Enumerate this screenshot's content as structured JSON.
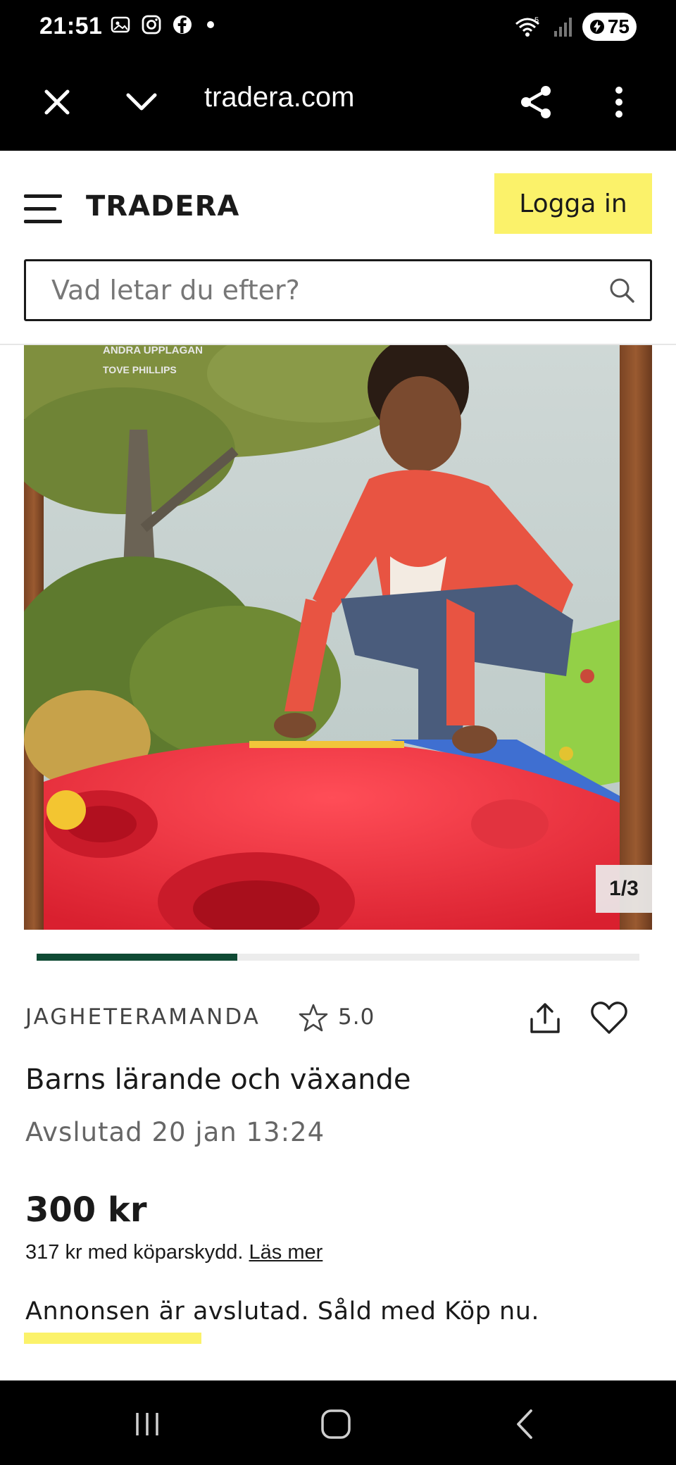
{
  "status_bar": {
    "time": "21:51",
    "battery": "75"
  },
  "browser": {
    "url": "tradera.com"
  },
  "header": {
    "logo": "TRADERA",
    "login_label": "Logga in"
  },
  "search": {
    "placeholder": "Vad letar du efter?"
  },
  "gallery": {
    "counter": "1/3",
    "progress_fraction": 0.3333
  },
  "listing": {
    "seller": "JAGHETERAMANDA",
    "rating": "5.0",
    "title": "Barns lärande och växande",
    "ended": "Avslutad 20 jan 13:24",
    "price": "300 kr",
    "protection_text": "317 kr med köparskydd. ",
    "protection_link": "Läs mer",
    "sold_note": "Annonsen är avslutad. Såld med Köp nu."
  },
  "colors": {
    "accent_yellow": "#fbf26a",
    "progress_green": "#0f4a34",
    "system_bar": "#000000"
  },
  "icons": [
    "close-icon",
    "chevron-down-icon",
    "share-icon",
    "more-vert-icon",
    "hamburger-icon",
    "search-icon",
    "star-icon",
    "upload-share-icon",
    "heart-icon",
    "recents-icon",
    "home-icon",
    "back-icon"
  ]
}
